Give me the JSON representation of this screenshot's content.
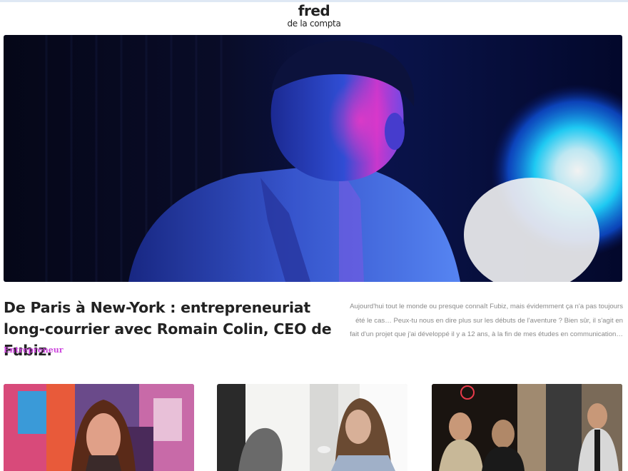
{
  "site": {
    "logo_main": "fred",
    "logo_sub": "de la compta"
  },
  "featured": {
    "title": "De Paris à New-York : entrepreneuriat long-courrier avec Romain Colin, CEO de Fubiz.",
    "category": "Entrepreneur",
    "excerpt": "Aujourd'hui tout le monde ou presque connaît Fubiz, mais évidemment ça n'a pas toujours été le cas… Peux-tu nous en dire plus sur les débuts de l'aventure ? Bien sûr, il s'agit en fait d'un projet que j'ai développé il y a 12 ans, à la fin de mes études en communication…"
  },
  "colors": {
    "accent": "#cc44dd",
    "title": "#222222",
    "excerpt": "#8a8a8a"
  },
  "cards": [
    {
      "image": "woman-graffiti-wall-photo"
    },
    {
      "image": "woman-with-phone-cafe-photo"
    },
    {
      "image": "men-at-restaurant-photo"
    }
  ]
}
